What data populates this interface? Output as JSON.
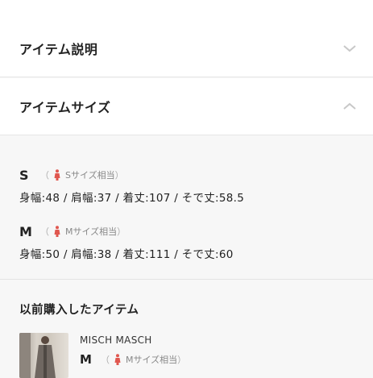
{
  "accordion": {
    "description_label": "アイテム説明",
    "size_label": "アイテムサイズ"
  },
  "sizes": [
    {
      "size": "S",
      "note": "Sサイズ相当",
      "measurements": "身幅:48 / 肩幅:37 / 着丈:107 / そで丈:58.5"
    },
    {
      "size": "M",
      "note": "Mサイズ相当",
      "measurements": "身幅:50 / 肩幅:38 / 着丈:111 / そで丈:60"
    }
  ],
  "previous": {
    "title": "以前購入したアイテム",
    "item": {
      "brand": "MISCH MASCH",
      "size": "M",
      "note": "Mサイズ相当"
    }
  },
  "colors": {
    "accent": "#e0574f",
    "text": "#222222",
    "muted": "#888888",
    "chevron": "#c8c8c8"
  },
  "icons": {
    "collapsed": "chevron-down-icon",
    "expanded": "chevron-up-icon",
    "size_figure": "person-figure-icon"
  }
}
